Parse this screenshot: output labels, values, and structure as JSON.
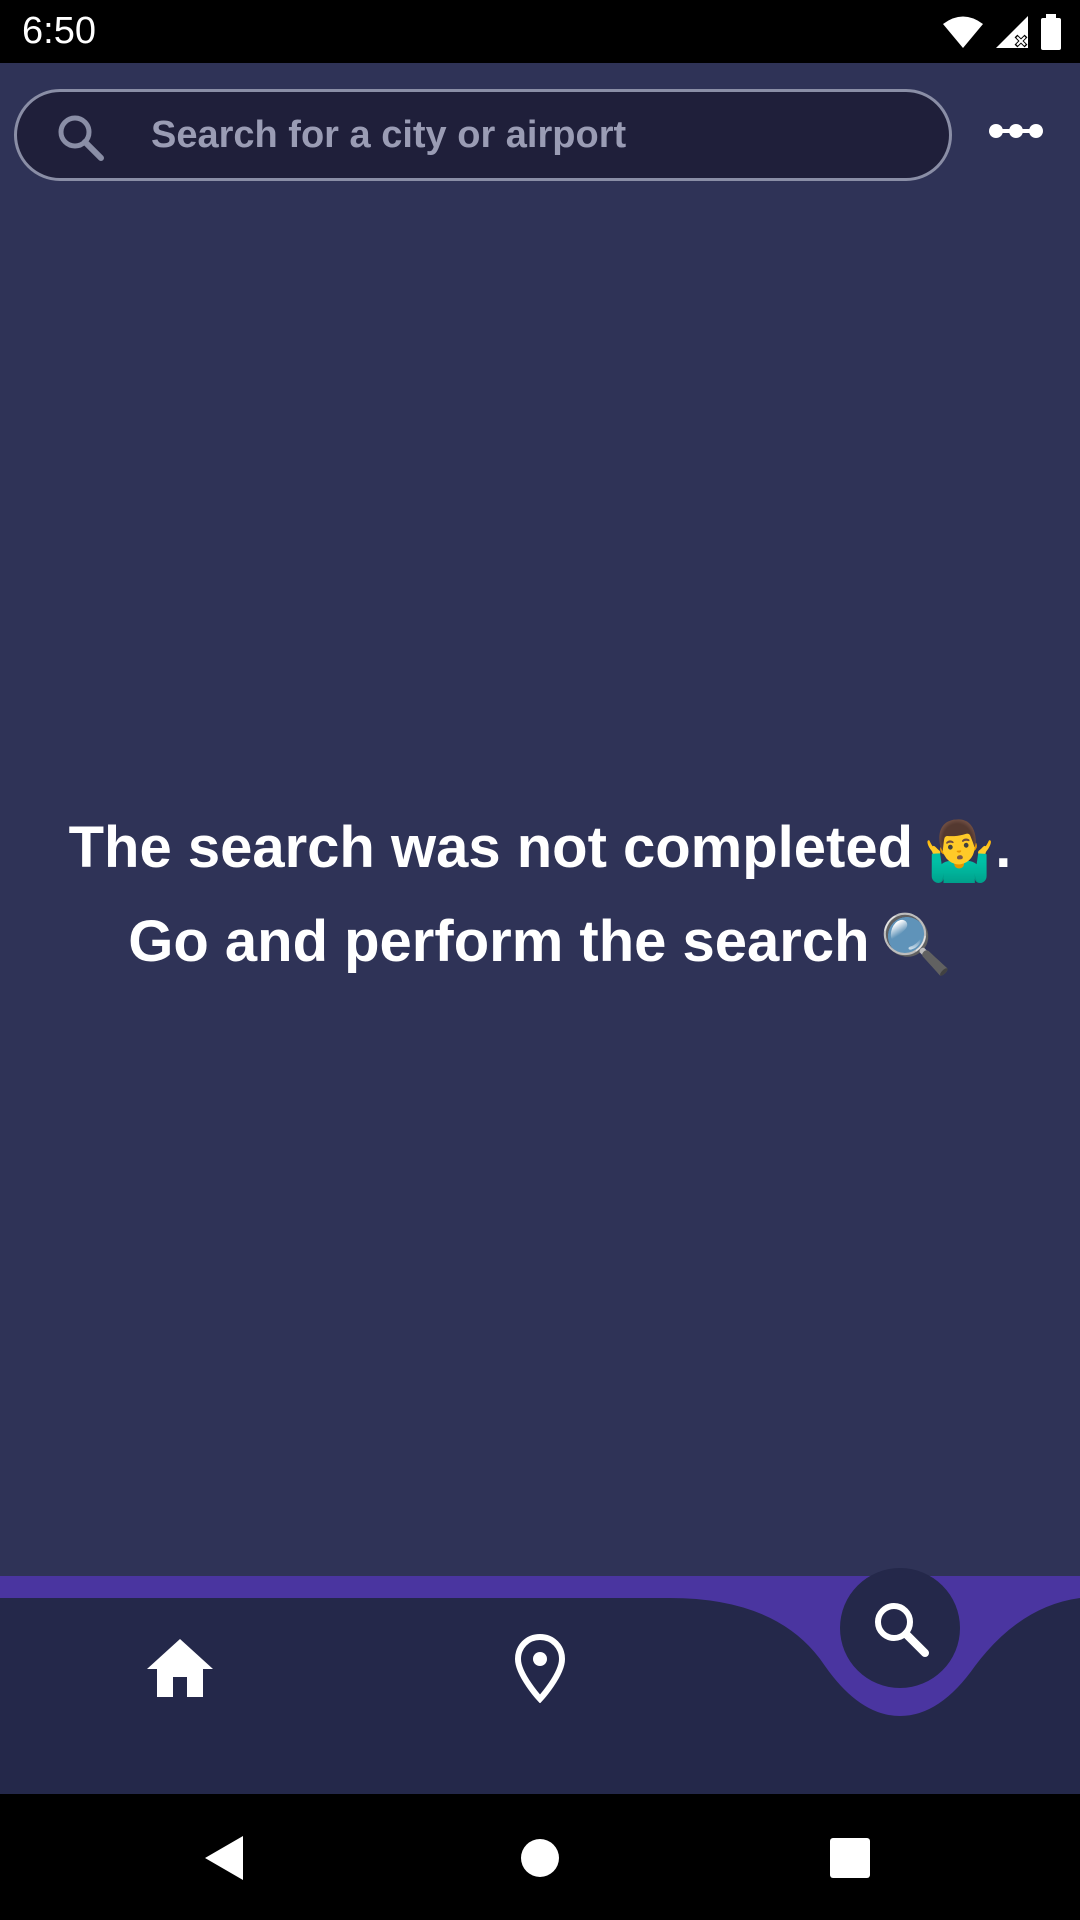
{
  "status_bar": {
    "time": "6:50",
    "icons": [
      "wifi-icon",
      "cell-signal-icon",
      "battery-icon"
    ]
  },
  "search": {
    "placeholder": "Search for a city or airport",
    "value": ""
  },
  "header": {
    "menu_icon": "more-options-icon"
  },
  "message": {
    "line1": "The search was not completed",
    "line1_end": ".",
    "line2": "Go and perform the search",
    "emoji1": "🤷‍♂️",
    "emoji2": "🔍"
  },
  "bottom_nav": {
    "items": [
      {
        "name": "home",
        "icon": "home-icon",
        "selected": false
      },
      {
        "name": "location",
        "icon": "location-pin-icon",
        "selected": false
      },
      {
        "name": "search",
        "icon": "search-icon",
        "selected": true
      }
    ]
  },
  "system_nav": {
    "buttons": [
      "back-icon",
      "home-circle-icon",
      "recents-icon"
    ]
  },
  "colors": {
    "background": "#2f3357",
    "search_field": "#1f1f3a",
    "nav_background": "#24284a",
    "accent": "#4a35a0",
    "text": "#ffffff",
    "placeholder": "#9a9cb4"
  }
}
